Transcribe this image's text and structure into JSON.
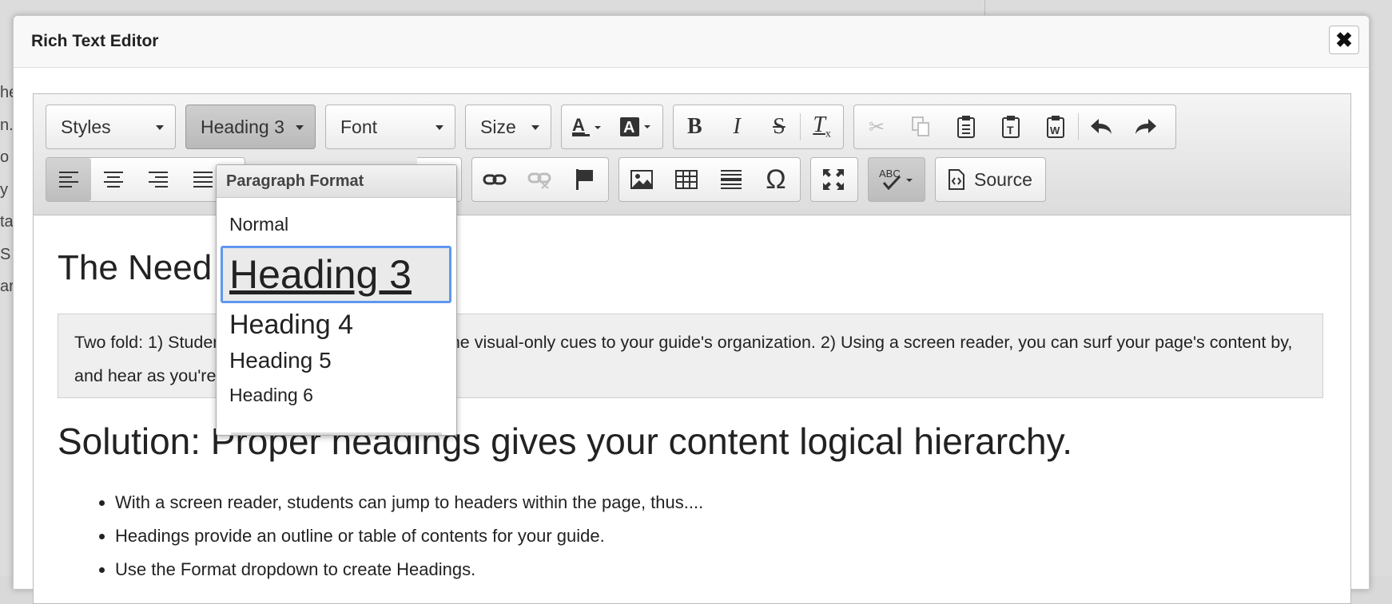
{
  "background": {
    "snippets": [
      "he",
      "n...",
      "o",
      "y",
      "ta",
      "S",
      "ar"
    ]
  },
  "dialog": {
    "title": "Rich Text Editor",
    "close_glyph": "✖"
  },
  "toolbar": {
    "styles_label": "Styles",
    "format_label": "Heading 3",
    "font_label": "Font",
    "size_label": "Size",
    "source_label": "Source"
  },
  "dropdown": {
    "header": "Paragraph Format",
    "items": [
      "Normal",
      "Heading 3",
      "Heading 4",
      "Heading 5",
      "Heading 6"
    ],
    "selected": "Heading 3"
  },
  "content": {
    "heading_need": "The Need",
    "note_text": "Two fold: 1) Students using screen readers miss the visual-only cues to your guide's organization. 2) Using a screen reader, you can surf your page's content by, and hear as you're tabbing by, the headers.",
    "heading_solution": "Solution: Proper headings gives your content logical hierarchy.",
    "bullets": [
      "With a screen reader, students can jump to headers within the page, thus....",
      "Headings provide an outline or table of contents for your guide.",
      "Use the Format dropdown to create Headings."
    ]
  },
  "icons": {
    "text_color": "text-color-icon",
    "bg_color": "background-color-icon",
    "bold": "bold-icon",
    "italic": "italic-icon",
    "strike": "strikethrough-icon",
    "remove_format": "remove-format-icon",
    "cut": "cut-icon",
    "copy": "copy-icon",
    "paste": "paste-icon",
    "paste_text": "paste-text-icon",
    "paste_word": "paste-word-icon",
    "undo": "undo-icon",
    "redo": "redo-icon",
    "align_left": "align-left-icon",
    "align_center": "align-center-icon",
    "align_right": "align-right-icon",
    "justify": "justify-icon",
    "blockquote": "blockquote-icon",
    "link": "link-icon",
    "unlink": "unlink-icon",
    "anchor": "anchor-icon",
    "image": "image-icon",
    "table": "table-icon",
    "hr": "horizontal-rule-icon",
    "special_char": "special-char-icon",
    "maximize": "maximize-icon",
    "spellcheck": "spellcheck-icon",
    "source": "source-icon"
  },
  "colors": {
    "focus_ring": "#5e97f0",
    "active_button": "#c4c4c4"
  }
}
